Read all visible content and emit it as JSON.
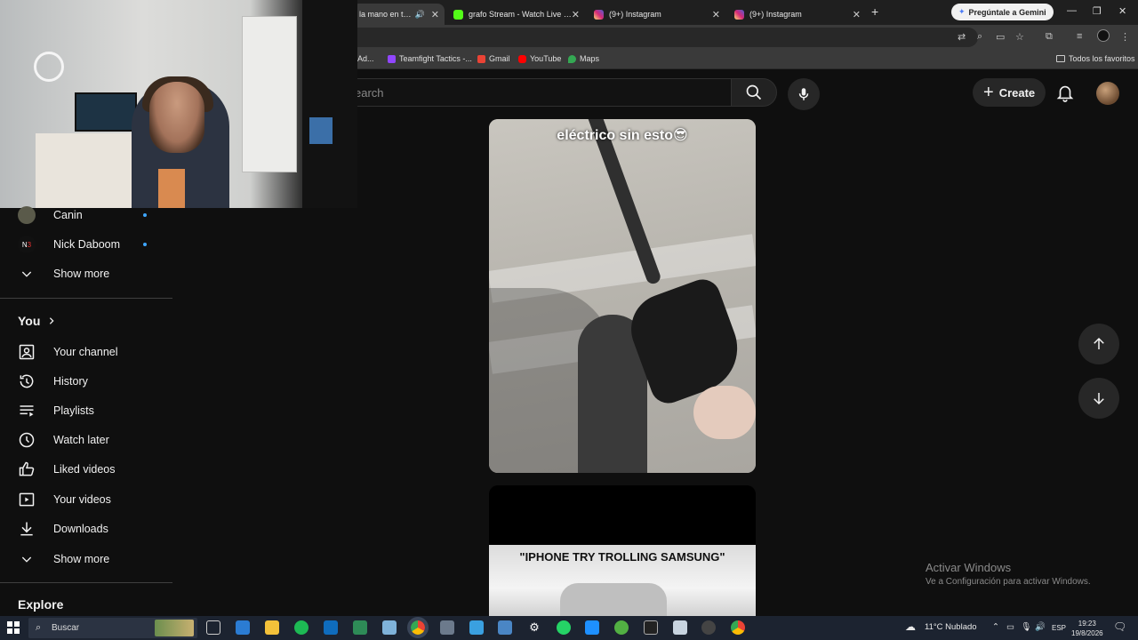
{
  "browser": {
    "tabs": [
      {
        "title": "la mano en tu d",
        "fav_color": "#444444",
        "active": true
      },
      {
        "title": "grafo Stream - Watch Live on K",
        "fav_color": "#53fc18",
        "active": false
      },
      {
        "title": "(9+) Instagram",
        "fav_color": "#d62976",
        "active": false
      },
      {
        "title": "(9+) Instagram",
        "fav_color": "#d62976",
        "active": false
      }
    ],
    "new_tab": "+",
    "gemini_label": "Pregúntale a Gemini",
    "bookmarks": [
      {
        "label": "Ad...",
        "color": "#888888"
      },
      {
        "label": "Teamfight Tactics -...",
        "color": "#9146ff"
      },
      {
        "label": "Gmail",
        "color": "#ea4335"
      },
      {
        "label": "YouTube",
        "color": "#ff0000"
      },
      {
        "label": "Maps",
        "color": "#34a853"
      }
    ],
    "all_bookmarks": "Todos los favoritos"
  },
  "header": {
    "search_placeholder": "Search",
    "visible_search_text": "earch",
    "create_label": "Create"
  },
  "sidebar": {
    "subscriptions": [
      {
        "label": "Canin",
        "live": true
      },
      {
        "label": "Nick Daboom",
        "live": true
      }
    ],
    "show_more_1": "Show more",
    "you_section": "You",
    "you_items": [
      {
        "label": "Your channel",
        "icon": "user-box-icon"
      },
      {
        "label": "History",
        "icon": "history-icon"
      },
      {
        "label": "Playlists",
        "icon": "playlists-icon"
      },
      {
        "label": "Watch later",
        "icon": "clock-icon"
      },
      {
        "label": "Liked videos",
        "icon": "thumb-up-icon"
      },
      {
        "label": "Your videos",
        "icon": "play-box-icon"
      },
      {
        "label": "Downloads",
        "icon": "download-icon"
      }
    ],
    "show_more_2": "Show more",
    "explore_section": "Explore"
  },
  "shorts": [
    {
      "caption": "eléctrico sin esto😎"
    },
    {
      "caption": "\"IPHONE TRY TROLLING SAMSUNG\""
    }
  ],
  "watermark": {
    "line1": "Activar Windows",
    "line2": "Ve a Configuración para activar Windows."
  },
  "taskbar": {
    "search_label": "Buscar",
    "weather": "11°C  Nublado",
    "lang": "ESP",
    "time": "19:23",
    "date": "19/8/2026"
  }
}
